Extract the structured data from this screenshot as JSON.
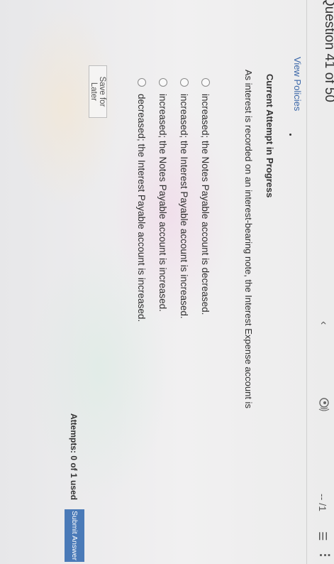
{
  "header": {
    "question_counter": "Question 41 of 50",
    "prev_icon": "chevron-left-icon",
    "reader_icon": "read-aloud-icon",
    "score": "-- /1",
    "menu_icon": "menu-icon",
    "more_icon": "more-options-icon"
  },
  "links": {
    "view_policies": "View Policies"
  },
  "attempt": {
    "heading": "Current Attempt in Progress"
  },
  "question": {
    "text": "As interest is recorded on an interest-bearing note, the Interest Expense account is",
    "options": [
      "increased; the Notes Payable account is decreased.",
      "increased; the Interest Payable account is increased.",
      "increased; the Notes Payable account is increased.",
      "decreased; the Interest Payable account is increased."
    ]
  },
  "footer": {
    "save_label": "Save for Later",
    "attempts_text": "Attempts: 0 of 1 used",
    "submit_label": "Submit Answer"
  },
  "colors": {
    "link": "#3a66a8",
    "submit_bg": "#4a7ab8"
  }
}
